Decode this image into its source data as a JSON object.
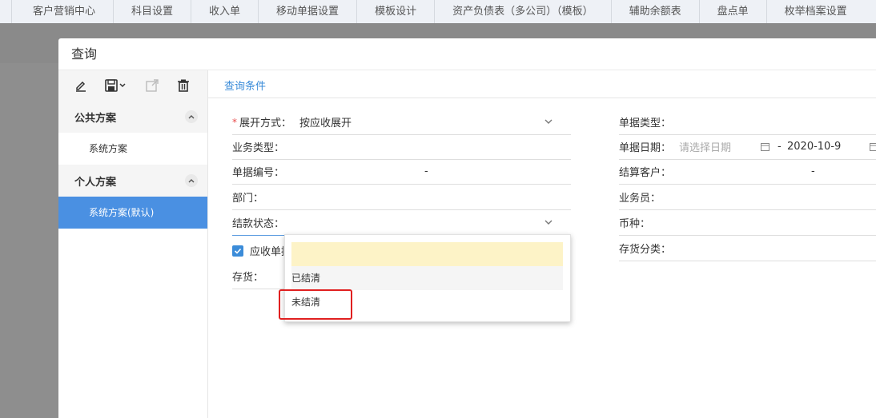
{
  "tabs": [
    "客户营销中心",
    "科目设置",
    "收入单",
    "移动单据设置",
    "模板设计",
    "资产负债表（多公司）（模板）",
    "辅助余额表",
    "盘点单",
    "枚举档案设置"
  ],
  "modal": {
    "title": "查询"
  },
  "sidebar": {
    "tools": [
      "edit-icon",
      "save-icon",
      "export-icon",
      "delete-icon"
    ],
    "groups": [
      {
        "name": "公共方案",
        "items": [
          {
            "label": "系统方案"
          }
        ]
      },
      {
        "name": "个人方案",
        "items": [
          {
            "label": "系统方案(默认)"
          }
        ]
      }
    ]
  },
  "content": {
    "tab": "查询条件",
    "left_fields": {
      "expand": {
        "label": "展开方式：",
        "value": "按应收展开"
      },
      "biz_type": {
        "label": "业务类型："
      },
      "doc_no": {
        "label": "单据编号：",
        "sep": "-"
      },
      "dept": {
        "label": "部门："
      },
      "settle_status": {
        "label": "结款状态："
      },
      "checkbox_label": "应收单据",
      "stock": {
        "label": "存货："
      }
    },
    "right_fields": {
      "doc_type": {
        "label": "单据类型："
      },
      "doc_date": {
        "label": "单据日期：",
        "placeholder": "请选择日期",
        "sep": "-",
        "end": "2020-10-9"
      },
      "customer": {
        "label": "结算客户：",
        "sep": "-"
      },
      "salesman": {
        "label": "业务员："
      },
      "currency": {
        "label": "币种："
      },
      "stock_cat": {
        "label": "存货分类："
      }
    },
    "dropdown": {
      "options": [
        "",
        "已结清",
        "未结清"
      ]
    }
  },
  "colors": {
    "accent": "#4a90e2",
    "highlight": "#e02020"
  }
}
